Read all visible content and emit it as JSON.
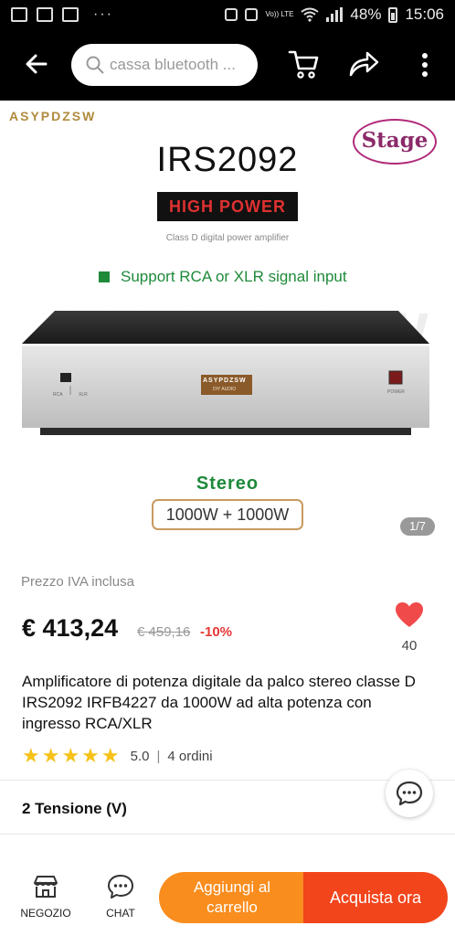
{
  "status_bar": {
    "network": "Vo)) LTE",
    "battery": "48%",
    "time": "15:06",
    "overflow_dots": "···"
  },
  "app_bar": {
    "search_placeholder": "cassa bluetooth ..."
  },
  "product_image": {
    "brand_logo": "ASYPDZSW",
    "model": "IRS2092",
    "stage_badge": "Stage",
    "power_banner": "HIGH POWER",
    "subtitle": "Class D digital power amplifier",
    "support_text": "Support RCA or XLR signal input",
    "watermark": "ASYPDZSW",
    "device_brand": "ASYPDZSW",
    "device_sub": "DIY AUDIO",
    "label_rca": "RCA",
    "label_xlr": "XLR",
    "label_power": "POWER",
    "stereo_label": "Stereo",
    "wattage": "1000W + 1000W",
    "pager": "1/7"
  },
  "details": {
    "vat_label": "Prezzo IVA inclusa",
    "price": "€ 413,24",
    "old_price": "€ 459,16",
    "discount": "-10%",
    "wishlist_count": "40",
    "title": "Amplificatore di potenza digitale da palco stereo classe D IRS2092 IRFB4227 da 1000W ad alta potenza con ingresso RCA/XLR",
    "rating_stars": "★★★★★",
    "rating_value": "5.0",
    "rating_separator": "|",
    "orders": "4 ordini",
    "option_label": "2 Tensione (V)"
  },
  "bottom_bar": {
    "shop_label": "NEGOZIO",
    "chat_label": "CHAT",
    "add_to_cart": "Aggiungi al carrello",
    "buy_now": "Acquista ora"
  },
  "colors": {
    "add_to_cart_bg": "#f98d1e",
    "buy_now_bg": "#f2451c",
    "discount": "#e53935",
    "stars": "#f6c21a",
    "support_green": "#1e8a3a"
  }
}
